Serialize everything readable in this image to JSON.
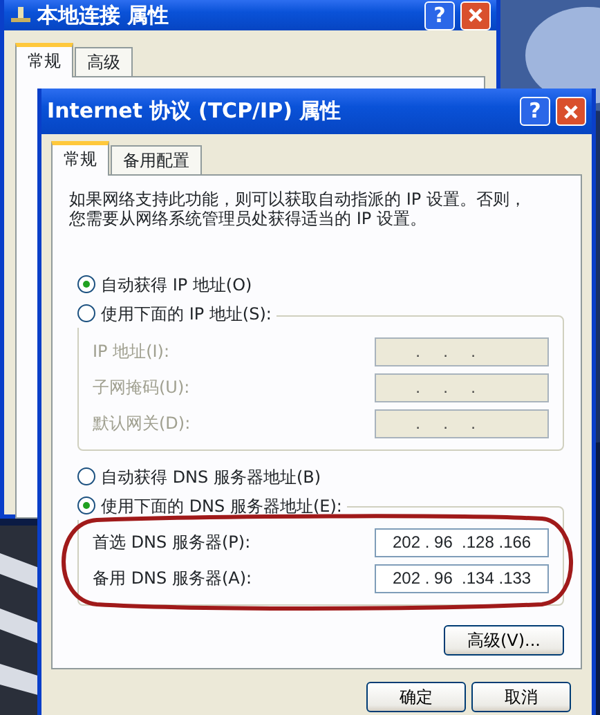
{
  "back_window": {
    "title": "本地连接 属性",
    "help_button": "?",
    "tabs": [
      {
        "label": "常规",
        "selected": true
      },
      {
        "label": "高级",
        "selected": false
      }
    ]
  },
  "dialog": {
    "title": "Internet 协议 (TCP/IP) 属性",
    "help_button": "?",
    "tabs": [
      {
        "label": "常规",
        "selected": true
      },
      {
        "label": "备用配置",
        "selected": false
      }
    ],
    "description": "如果网络支持此功能，则可以获取自动指派的 IP 设置。否则，您需要从网络系统管理员处获得适当的 IP 设置。",
    "ip_options": [
      {
        "label": "自动获得 IP 地址(O)",
        "selected": true
      },
      {
        "label": "使用下面的 IP 地址(S):",
        "selected": false
      }
    ],
    "ip_fields": [
      {
        "label": "IP 地址(I):",
        "value": "     .     .     .",
        "disabled": true
      },
      {
        "label": "子网掩码(U):",
        "value": "     .     .     .",
        "disabled": true
      },
      {
        "label": "默认网关(D):",
        "value": "     .     .     .",
        "disabled": true
      }
    ],
    "dns_options": [
      {
        "label": "自动获得 DNS 服务器地址(B)",
        "selected": false
      },
      {
        "label": "使用下面的 DNS 服务器地址(E):",
        "selected": true
      }
    ],
    "dns_fields": [
      {
        "label": "首选 DNS 服务器(P):",
        "value": "202 . 96  .128 .166",
        "disabled": false
      },
      {
        "label": "备用 DNS 服务器(A):",
        "value": "202 . 96  .134 .133",
        "disabled": false
      }
    ],
    "advanced_button": "高级(V)...",
    "buttons": [
      "确定",
      "取消"
    ]
  },
  "annotation": {
    "kind": "ellipse"
  }
}
